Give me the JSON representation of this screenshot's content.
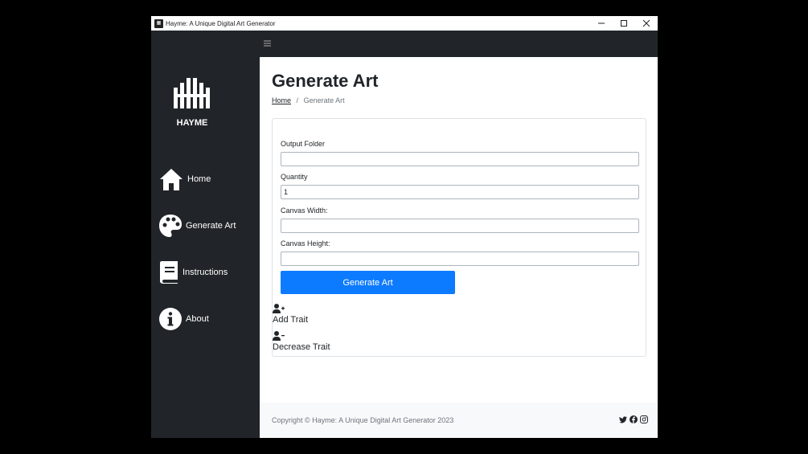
{
  "window": {
    "title": "Hayme: A Unique Digital Art Generator",
    "app_icon": "hayme-app-icon",
    "controls": [
      "minimize-icon",
      "maximize-icon",
      "close-icon"
    ]
  },
  "topbar": {
    "menu_icon": "hamburger-icon"
  },
  "sidebar": {
    "logo_text": "HAYME",
    "items": [
      {
        "label": "Home",
        "icon": "home-icon"
      },
      {
        "label": "Generate Art",
        "icon": "palette-icon"
      },
      {
        "label": "Instructions",
        "icon": "book-icon"
      },
      {
        "label": "About",
        "icon": "info-icon"
      }
    ]
  },
  "main": {
    "title": "Generate Art",
    "breadcrumb": {
      "home": "Home",
      "separator": "/",
      "current": "Generate Art"
    },
    "form": {
      "output_folder": {
        "label": "Output Folder",
        "value": ""
      },
      "quantity": {
        "label": "Quantity",
        "value": "1"
      },
      "canvas_width": {
        "label": "Canvas Width:",
        "value": ""
      },
      "canvas_height": {
        "label": "Canvas Height:",
        "value": ""
      },
      "submit_label": "Generate Art"
    },
    "add_trait": {
      "label": "Add Trait",
      "icon": "user-plus-icon"
    },
    "decrease_trait": {
      "label": "Decrease Trait",
      "icon": "user-minus-icon"
    }
  },
  "footer": {
    "copyright": "Copyright © Hayme: A Unique Digital Art Generator 2023",
    "social": [
      "twitter-icon",
      "facebook-icon",
      "instagram-icon"
    ]
  },
  "colors": {
    "sidebar_bg": "#212529",
    "primary": "#0d7bff",
    "footer_bg": "#f8f9fa"
  }
}
